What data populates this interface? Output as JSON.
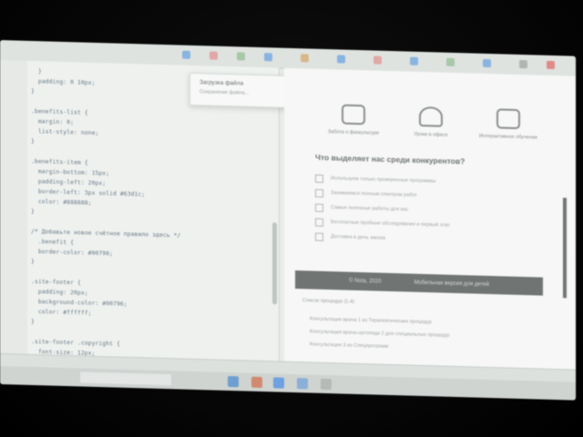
{
  "popup": {
    "title": "Загрузка файла",
    "subtitle": "Сохранение файла..."
  },
  "editor": {
    "lines": [
      "  }",
      "  padding: 0 10px;",
      "}",
      "",
      ".benefits-list {",
      "  margin: 0;",
      "  list-style: none;",
      "}",
      "",
      ".benefits-item {",
      "  margin-bottom: 15px;",
      "  padding-left: 20px;",
      "  border-left: 3px solid #63d1c;",
      "  color: #888888;",
      "}",
      "",
      "/* Добавьте новое счётное правило здесь */",
      "  .benefit {",
      "  border-color: #00796;",
      "}",
      "",
      ".site-footer {",
      "  padding: 20px;",
      "  background-color: #00796;",
      "  color: #ffffff;",
      "}",
      "",
      ".site-footer .copyright {",
      "  font-size: 12px;",
      "}"
    ]
  },
  "preview": {
    "features": [
      {
        "label": "Забота о физкультуре",
        "icon": "sofa-icon"
      },
      {
        "label": "Уроки в офисе",
        "icon": "kettlebell-icon"
      },
      {
        "label": "Интерактивное обучение",
        "icon": "screen-icon"
      }
    ],
    "heading": "Что выделяет нас среди конкурентов?",
    "checklist": [
      "Используем только проверенные программы",
      "Занимаемся полным спектром работ",
      "Самые полезные работы для вас",
      "Бесплатные пробные обследования и первый этап",
      "Доставка в день заказа"
    ],
    "darkbar": {
      "left": "© Nota, 2020",
      "right": "Мобильная версия для детей"
    },
    "section_title": "Список процедур (1-4)",
    "items": [
      "Консультация врача 1 из Терапевтических процедур",
      "Консультация врача-ортопеда 2 для специальных процедур",
      "Консультация 3 из Спецпрограмм"
    ]
  },
  "colors": {
    "accent": "#5b9bd5",
    "darkbar": "#707573"
  }
}
